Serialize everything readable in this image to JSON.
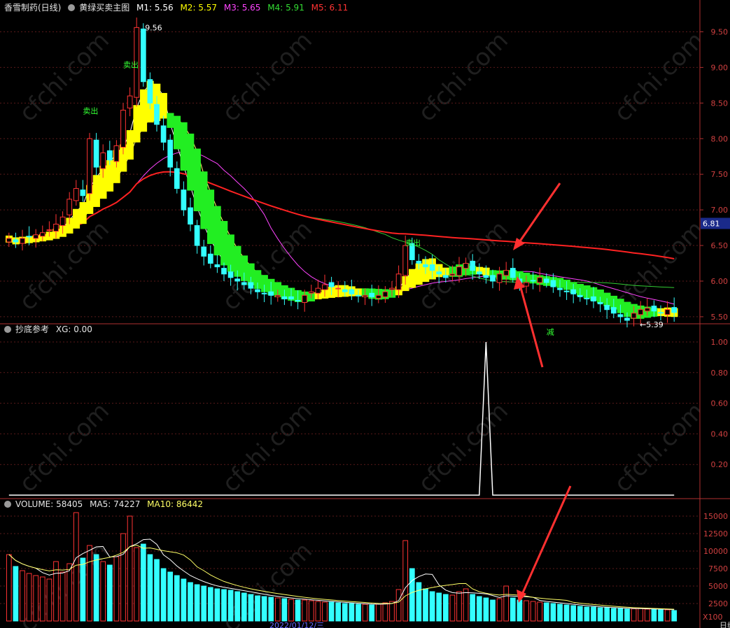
{
  "header": {
    "stock": "香雪制药(日线)",
    "indicator": "黄绿买卖主图",
    "ma": [
      {
        "label": "M1: 5.56",
        "color": "#ffffff"
      },
      {
        "label": "M2: 5.57",
        "color": "#ffff00"
      },
      {
        "label": "M3: 5.65",
        "color": "#ff44ff"
      },
      {
        "label": "M4: 5.91",
        "color": "#33dd33"
      },
      {
        "label": "M5: 6.11",
        "color": "#ff3333"
      }
    ]
  },
  "sub1": {
    "title": "抄底参考",
    "xg": "XG: 0.00"
  },
  "sub2": {
    "volume": "VOLUME: 58405",
    "ma5": "MA5: 74227",
    "ma10": "MA10: 86442"
  },
  "chart_data": [
    {
      "type": "candlestick",
      "ylim": [
        5.45,
        9.75
      ],
      "yticks": [
        "5.50",
        "6.00",
        "6.50",
        "7.00",
        "7.50",
        "8.00",
        "8.50",
        "9.00",
        "9.50"
      ],
      "current_price": "6.81",
      "annotations": {
        "high": "9.56",
        "low": "5.39",
        "sell": "卖出",
        "reduce": "减"
      },
      "closes": [
        6.6,
        6.55,
        6.6,
        6.62,
        6.65,
        6.68,
        6.72,
        6.8,
        6.9,
        7.15,
        7.3,
        7.2,
        8.0,
        7.6,
        7.8,
        7.7,
        7.9,
        8.4,
        8.6,
        9.56,
        8.8,
        8.5,
        8.2,
        7.95,
        7.6,
        7.3,
        7.0,
        6.8,
        6.5,
        6.35,
        6.25,
        6.2,
        6.1,
        6.05,
        6.0,
        5.95,
        5.9,
        5.85,
        5.82,
        5.8,
        5.8,
        5.75,
        5.75,
        5.72,
        5.8,
        5.85,
        5.9,
        5.95,
        5.92,
        5.9,
        5.85,
        5.82,
        5.8,
        5.8,
        5.78,
        5.8,
        5.85,
        5.9,
        6.1,
        6.5,
        6.3,
        6.25,
        6.2,
        6.15,
        6.1,
        6.05,
        6.1,
        6.2,
        6.25,
        6.15,
        6.1,
        6.05,
        6.0,
        6.1,
        6.15,
        6.05,
        5.95,
        5.98,
        6.0,
        6.05,
        5.98,
        5.92,
        5.88,
        5.85,
        5.82,
        5.78,
        5.75,
        5.72,
        5.68,
        5.6,
        5.55,
        5.5,
        5.45,
        5.55,
        5.6,
        5.62,
        5.58,
        5.55,
        5.6,
        5.56
      ]
    },
    {
      "type": "line",
      "name": "XG",
      "ylim": [
        0,
        1.05
      ],
      "yticks": [
        "0.20",
        "0.40",
        "0.60",
        "0.80",
        "1.00"
      ],
      "spike_index": 71,
      "spike_value": 1.0
    },
    {
      "type": "bar",
      "name": "VOLUME",
      "ylim": [
        0,
        16000
      ],
      "yticks": [
        "2500",
        "5000",
        "7500",
        "10000",
        "12500",
        "15000"
      ],
      "unit": "X100",
      "x_label": "2022/01/12/三",
      "period": "日线",
      "values": [
        9500,
        7800,
        7200,
        6800,
        6500,
        6300,
        6000,
        8500,
        7000,
        8200,
        15500,
        9000,
        10800,
        9500,
        8500,
        8000,
        9200,
        12500,
        15000,
        10500,
        11000,
        9500,
        8800,
        7500,
        7000,
        6500,
        6000,
        5500,
        5200,
        5000,
        4800,
        4600,
        4500,
        4400,
        4200,
        4000,
        3800,
        3600,
        3500,
        3400,
        3300,
        3200,
        3100,
        3000,
        3000,
        2900,
        2800,
        2700,
        2700,
        2600,
        2500,
        2500,
        2400,
        2400,
        2300,
        2400,
        2600,
        2800,
        4500,
        11500,
        7500,
        5500,
        4600,
        4200,
        4000,
        3800,
        3700,
        4200,
        4600,
        3800,
        3500,
        3300,
        3000,
        3200,
        5000,
        3300,
        3000,
        2900,
        2800,
        2700,
        2600,
        2500,
        2400,
        2300,
        2200,
        2100,
        2000,
        2000,
        1900,
        1900,
        1800,
        1800,
        1700,
        1750,
        1800,
        1700,
        1650,
        1600,
        1600,
        1500
      ]
    }
  ],
  "watermark": "cfchi.com"
}
